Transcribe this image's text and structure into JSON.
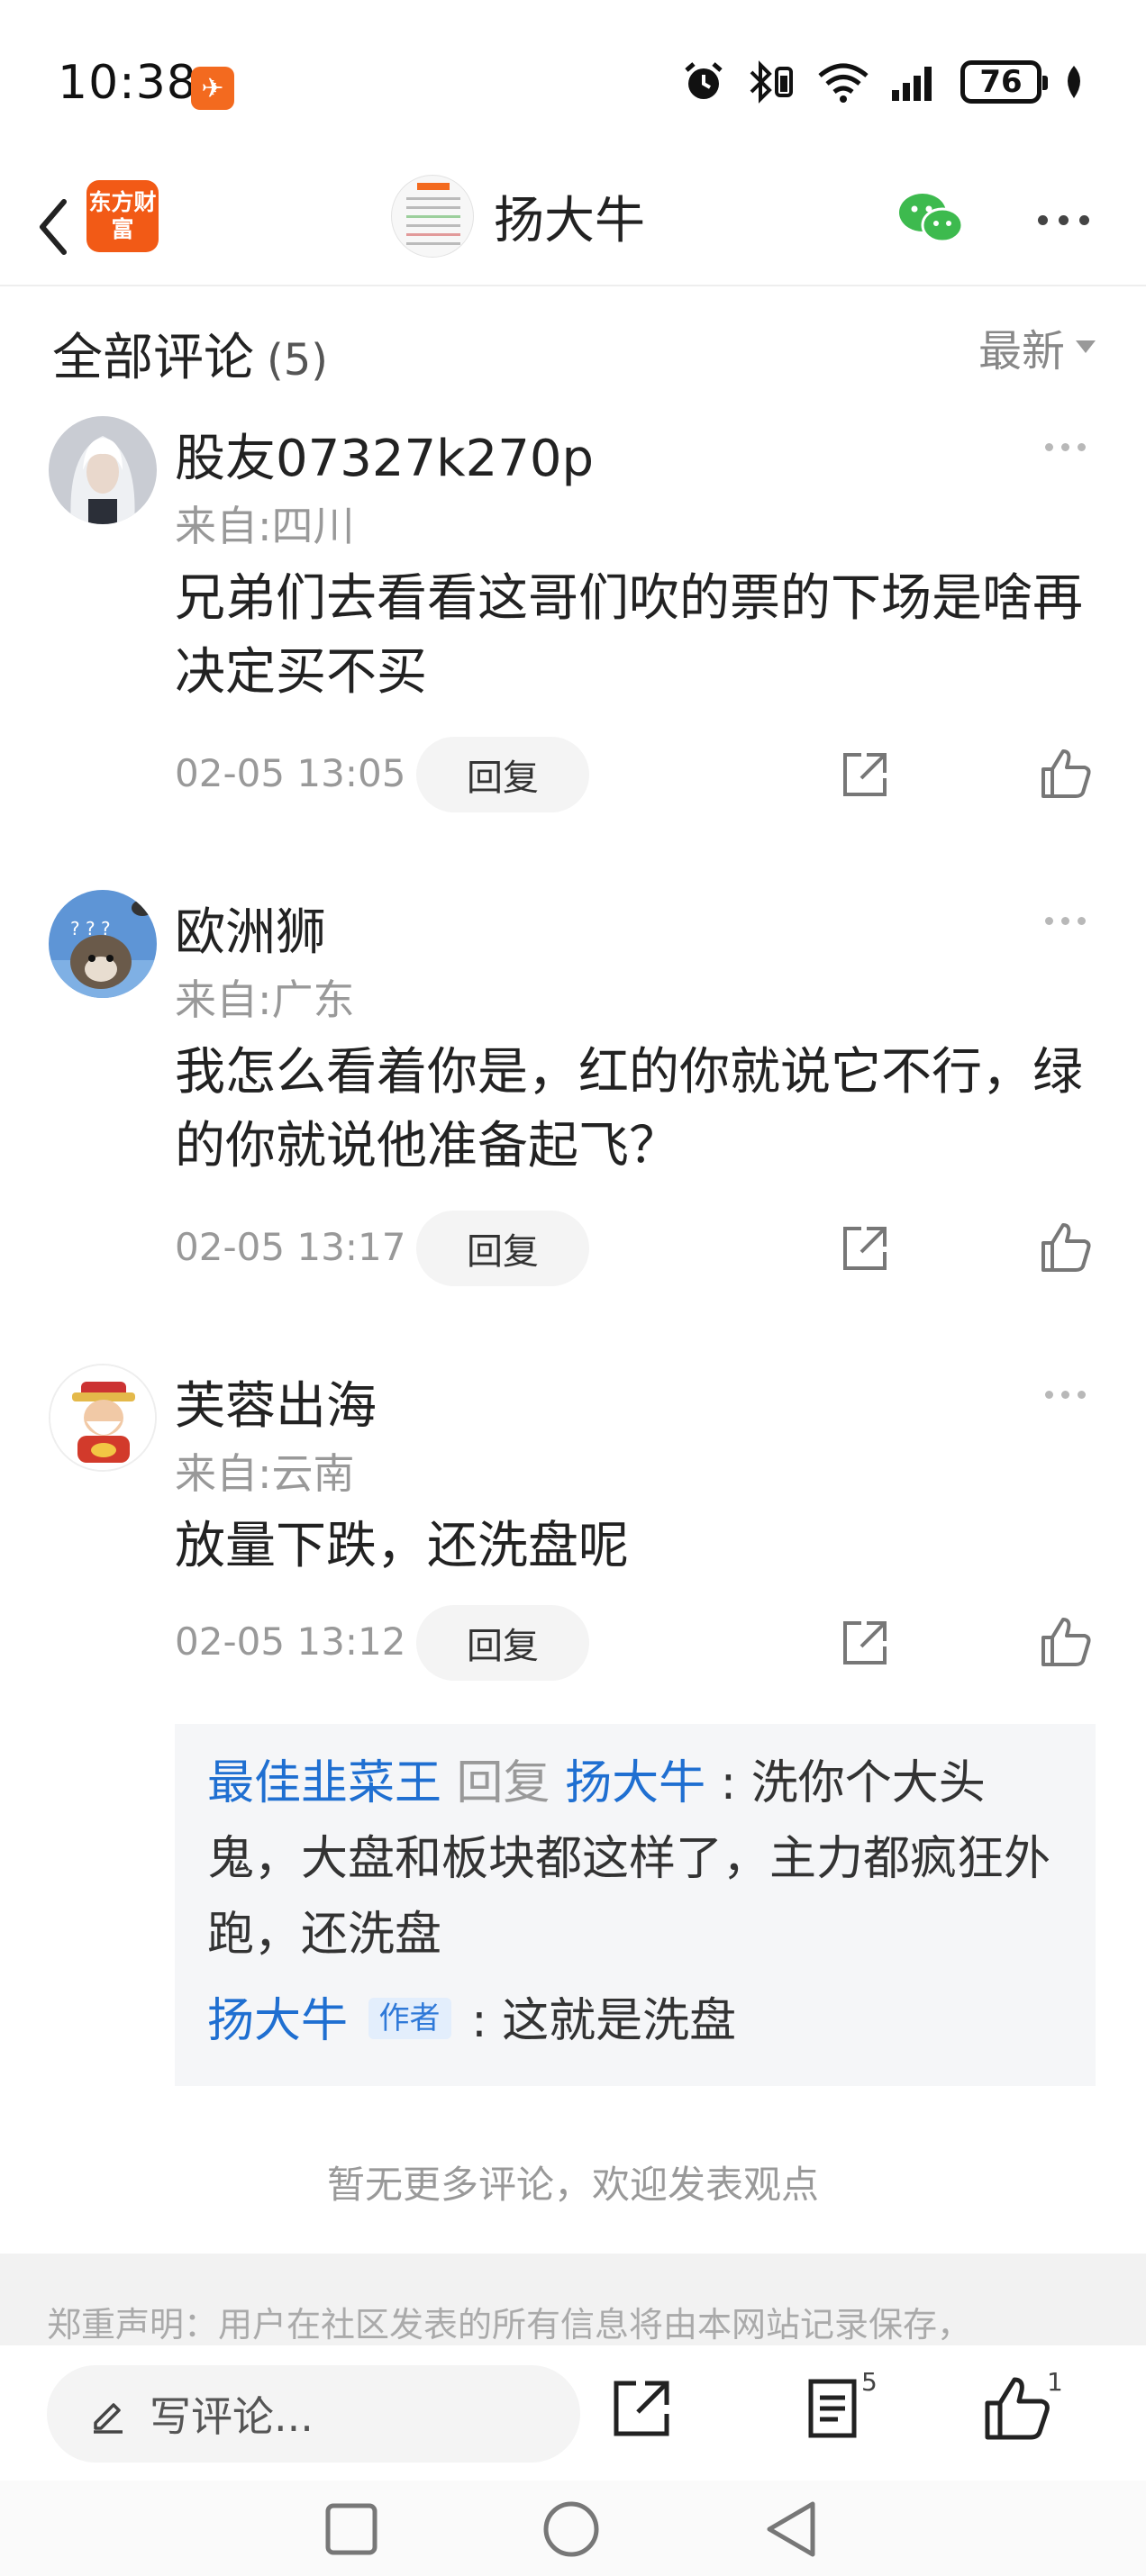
{
  "status_bar": {
    "time": "10:38",
    "battery": "76"
  },
  "nav": {
    "logo_text": "东方财富",
    "title": "扬大牛"
  },
  "header": {
    "title": "全部评论",
    "count": "(5)",
    "sort_label": "最新"
  },
  "comments": [
    {
      "username": "股友07327k270p",
      "location": "来自:四川",
      "content": "兄弟们去看看这哥们吹的票的下场是啥再决定买不买",
      "time": "02-05 13:05",
      "reply_label": "回复"
    },
    {
      "username": "欧洲狮",
      "location": "来自:广东",
      "content": "我怎么看着你是，红的你就说它不行，绿的你就说他准备起飞？",
      "time": "02-05 13:17",
      "reply_label": "回复"
    },
    {
      "username": "芙蓉出海",
      "location": "来自:云南",
      "content": "放量下跌，还洗盘呢",
      "time": "02-05 13:12",
      "reply_label": "回复"
    }
  ],
  "sub_replies": [
    {
      "user": "最佳韭菜王",
      "reply_word": "回复",
      "target": "扬大牛",
      "sep": " : ",
      "text": "洗你个大头鬼，大盘和板块都这样了，主力都疯狂外跑，还洗盘"
    },
    {
      "user": "扬大牛",
      "badge": "作者",
      "sep": " : ",
      "text": "这就是洗盘"
    }
  ],
  "footer": {
    "no_more": "暂无更多评论，欢迎发表观点",
    "disclaimer": "郑重声明：用户在社区发表的所有信息将由本网站记录保存，"
  },
  "bottom_bar": {
    "write_placeholder": "写评论...",
    "comment_count": "5",
    "like_count": "1"
  },
  "colors": {
    "brand_orange": "#f25a16",
    "link_blue": "#1f6fd1",
    "wechat_green": "#3dba4e"
  },
  "icons": [
    "back-icon",
    "wechat-icon",
    "more-icon",
    "share-icon",
    "like-icon",
    "pencil-icon",
    "comment-list-icon",
    "alarm-icon",
    "bluetooth-icon",
    "wifi-icon",
    "signal-icon",
    "leaf-icon"
  ]
}
